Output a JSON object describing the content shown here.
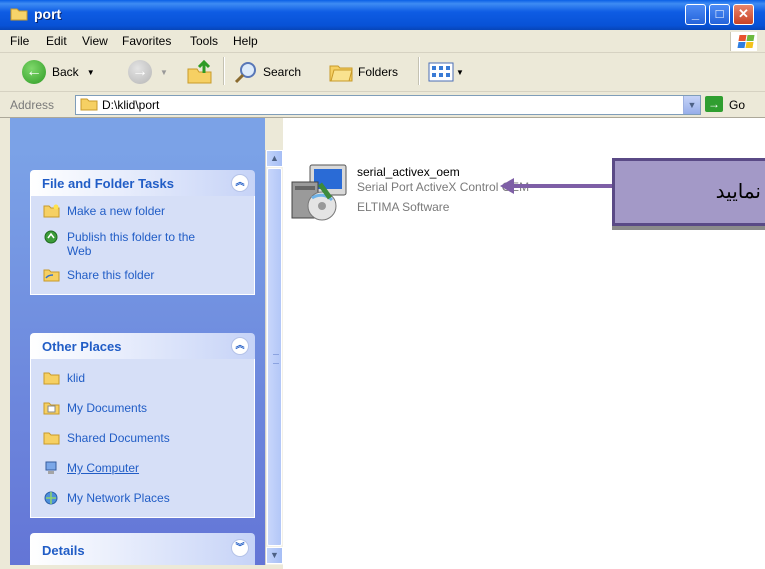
{
  "window": {
    "title": "port"
  },
  "menu": [
    "File",
    "Edit",
    "View",
    "Favorites",
    "Tools",
    "Help"
  ],
  "toolbar": {
    "back_label": "Back",
    "search_label": "Search",
    "folders_label": "Folders"
  },
  "address": {
    "label": "Address",
    "value": "D:\\klid\\port",
    "go_label": "Go"
  },
  "tasks": {
    "file_folder": {
      "title": "File and Folder Tasks",
      "items": [
        "Make a new folder",
        "Publish this folder to the Web",
        "Share this folder"
      ]
    },
    "other_places": {
      "title": "Other Places",
      "items": [
        "klid",
        "My Documents",
        "Shared Documents",
        "My Computer",
        "My Network Places"
      ]
    },
    "details": {
      "title": "Details"
    }
  },
  "file": {
    "name": "serial_activex_oem",
    "description": "Serial Port ActiveX Control OEM",
    "vendor": "ELTIMA Software"
  },
  "callout": {
    "text": "نمایید"
  },
  "colors": {
    "titlebar": "#0852D6",
    "taskpane": "#7BA2E7",
    "link": "#215DC6",
    "callout": "#A399C7",
    "arrow": "#7E5FA6"
  }
}
